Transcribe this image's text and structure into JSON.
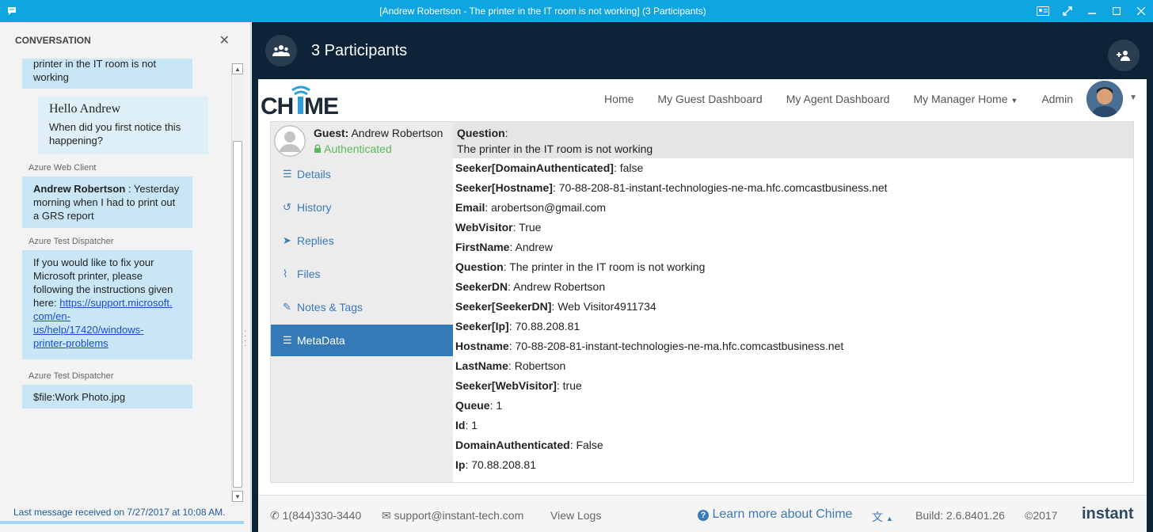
{
  "window": {
    "title": "[Andrew Robertson - The printer in the IT room is not working] (3 Participants)"
  },
  "conversation": {
    "header": "CONVERSATION",
    "messages": [
      {
        "sender": "",
        "lines": [
          "printer in the IT room is not",
          "working"
        ]
      },
      {
        "sender": "",
        "heading": "Hello Andrew",
        "lines": [
          "When did you first notice this",
          "happening?"
        ]
      },
      {
        "sender": "Azure Web Client",
        "bold": "Andrew Robertson",
        "lines": [
          " : Yesterday",
          "morning when I had to print out",
          "a GRS report"
        ]
      },
      {
        "sender": "Azure Test Dispatcher",
        "lines": [
          "If you would like to fix your",
          "Microsoft printer, please",
          "following the instructions given",
          "here: "
        ],
        "link_lines": [
          "https://support.microsoft.",
          "com/en-",
          "us/help/17420/windows-",
          "printer-problems"
        ]
      },
      {
        "sender": "Azure Test Dispatcher",
        "lines": [
          "$file:Work Photo.jpg"
        ]
      }
    ],
    "last_message": "Last message received on 7/27/2017 at 10:08 AM."
  },
  "participants": {
    "label": "3 Participants"
  },
  "nav": {
    "logo": "CHIME",
    "items": [
      "Home",
      "My Guest Dashboard",
      "My Agent Dashboard",
      "My Manager Home",
      "Admin"
    ]
  },
  "guest": {
    "label": "Guest:",
    "name": "Andrew Robertson",
    "status": "Authenticated",
    "question_label": "Question",
    "question": "The printer in the IT room is not working"
  },
  "sidebar": {
    "items": [
      "Details",
      "History",
      "Replies",
      "Files",
      "Notes & Tags"
    ],
    "active": "MetaData"
  },
  "metadata": [
    {
      "key": "Seeker[DomainAuthenticated]",
      "value": "false"
    },
    {
      "key": "Seeker[Hostname]",
      "value": "70-88-208-81-instant-technologies-ne-ma.hfc.comcastbusiness.net"
    },
    {
      "key": "Email",
      "value": "arobertson@gmail.com"
    },
    {
      "key": "WebVisitor",
      "value": "True"
    },
    {
      "key": "FirstName",
      "value": "Andrew"
    },
    {
      "key": "Question",
      "value": "The printer in the IT room is not working"
    },
    {
      "key": "SeekerDN",
      "value": "Andrew Robertson"
    },
    {
      "key": "Seeker[SeekerDN]",
      "value": "Web Visitor4911734"
    },
    {
      "key": "Seeker[Ip]",
      "value": "70.88.208.81"
    },
    {
      "key": "Hostname",
      "value": "70-88-208-81-instant-technologies-ne-ma.hfc.comcastbusiness.net"
    },
    {
      "key": "LastName",
      "value": "Robertson"
    },
    {
      "key": "Seeker[WebVisitor]",
      "value": "true"
    },
    {
      "key": "Queue",
      "value": "1"
    },
    {
      "key": "Id",
      "value": "1"
    },
    {
      "key": "DomainAuthenticated",
      "value": "False"
    },
    {
      "key": "Ip",
      "value": "70.88.208.81"
    }
  ],
  "footer": {
    "phone": "1(844)330-3440",
    "email": "support@instant-tech.com",
    "logs": "View Logs",
    "learn": "Learn more about Chime",
    "build": "Build: 2.6.8401.26",
    "copyright": "©2017",
    "brand": "instant"
  },
  "colors": {
    "titlebar": "#0ea5e0",
    "main_bg": "#0c2338",
    "active_tab": "#337ab7",
    "auth_green": "#5cb85c"
  }
}
